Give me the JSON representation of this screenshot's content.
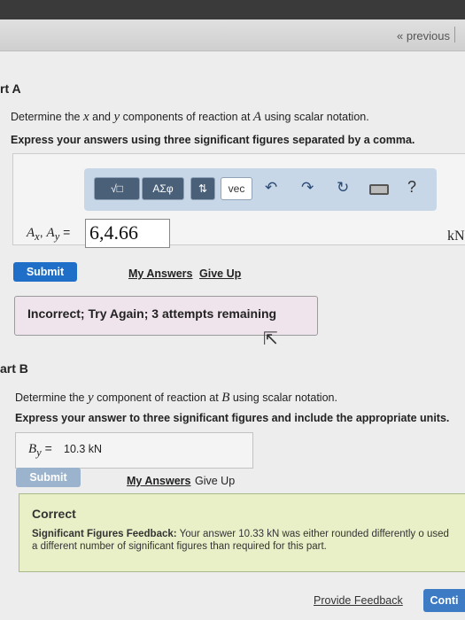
{
  "nav": {
    "previous_label": "« previous"
  },
  "partA": {
    "title": "rt A",
    "question": "Determine the x and y components of reaction at A using scalar notation.",
    "instruction": "Express your answers using three significant figures separated by a comma.",
    "toolbar": {
      "template_label": "√□",
      "greek_label": "ΑΣφ",
      "sort_label": "⇅",
      "vec_label": "vec",
      "undo_icon": "undo-icon",
      "redo_icon": "redo-icon",
      "reset_icon": "reset-icon",
      "keyboard_icon": "keyboard-icon",
      "help_label": "?"
    },
    "answer_label": "Ax, Ay =",
    "answer_value": "6,4.66",
    "unit": "kN",
    "submit_label": "Submit",
    "my_answers_label": "My Answers",
    "give_up_label": "Give Up",
    "result_message": "Incorrect; Try Again; 3 attempts remaining"
  },
  "partB": {
    "title": "art B",
    "question": "Determine the y component of reaction at B using scalar notation.",
    "instruction": "Express your answer to three significant figures and include the appropriate units.",
    "answer_label": "By =",
    "answer_value": "10.3 kN",
    "submit_label": "Submit",
    "my_answers_label": "My Answers",
    "give_up_label": "Give Up",
    "result_title": "Correct",
    "feedback_label": "Significant Figures Feedback:",
    "feedback_text": "Your answer 10.33 kN was either rounded differently o used a different number of significant figures than required for this part."
  },
  "footer": {
    "provide_feedback_label": "Provide Feedback",
    "continue_label": "Conti"
  },
  "colors": {
    "submit_active": "#1f6fc9",
    "submit_disabled": "#9bb3cc",
    "continue": "#3d7bc4",
    "incorrect_bg": "#f0e4ec",
    "correct_bg": "#e9f0c8"
  }
}
